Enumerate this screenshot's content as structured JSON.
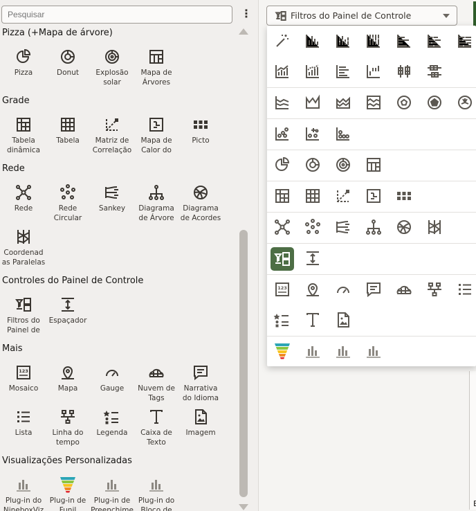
{
  "search": {
    "placeholder": "Pesquisar"
  },
  "menu_icon": "more-vertical-icon",
  "sections": {
    "pie": "Pizza (+Mapa de árvore)",
    "grid": "Grade",
    "network": "Rede",
    "dashboard_controls": "Controles do Painel de Controle",
    "more": "Mais",
    "custom": "Visualizações Personalizadas"
  },
  "tiles": {
    "pizza": "Pizza",
    "donut": "Donut",
    "explosao": "Explosão solar",
    "treemap": "Mapa de Árvores",
    "pivot": "Tabela dinâmica",
    "tabela": "Tabela",
    "matriz": "Matriz de Correlação",
    "heatmap": "Mapa de Calor do",
    "picto": "Picto",
    "rede": "Rede",
    "rede_circular": "Rede Circular",
    "sankey": "Sankey",
    "diagrama_arvore": "Diagrama de Árvore",
    "diagrama_acordes": "Diagrama de Acordes",
    "paralelas": "Coordenad as Paralelas",
    "filtros": "Filtros do Painel de",
    "espacador": "Espaçador",
    "mosaico": "Mosaico",
    "mapa": "Mapa",
    "gauge": "Gauge",
    "nuvem": "Nuvem de Tags",
    "narrativa": "Narrativa do Idioma",
    "lista": "Lista",
    "linha_tempo": "Linha do tempo",
    "legenda": "Legenda",
    "caixa_texto": "Caixa de Texto",
    "imagem": "Imagem",
    "plugin_ninebox": "Plug-in do NineboxViz",
    "plugin_funil": "Plug-in de Funil",
    "plugin_preenchimento": "Plug-in de Preenchime",
    "plugin_bloco": "Plug-in do Bloco de"
  },
  "dropdown": {
    "selected": "Filtros do Painel de Controle"
  },
  "edge_label": "E",
  "colors": {
    "accent": "#4d6e45",
    "icon": "#5b5751",
    "dark_green": "#2f5c2a"
  }
}
